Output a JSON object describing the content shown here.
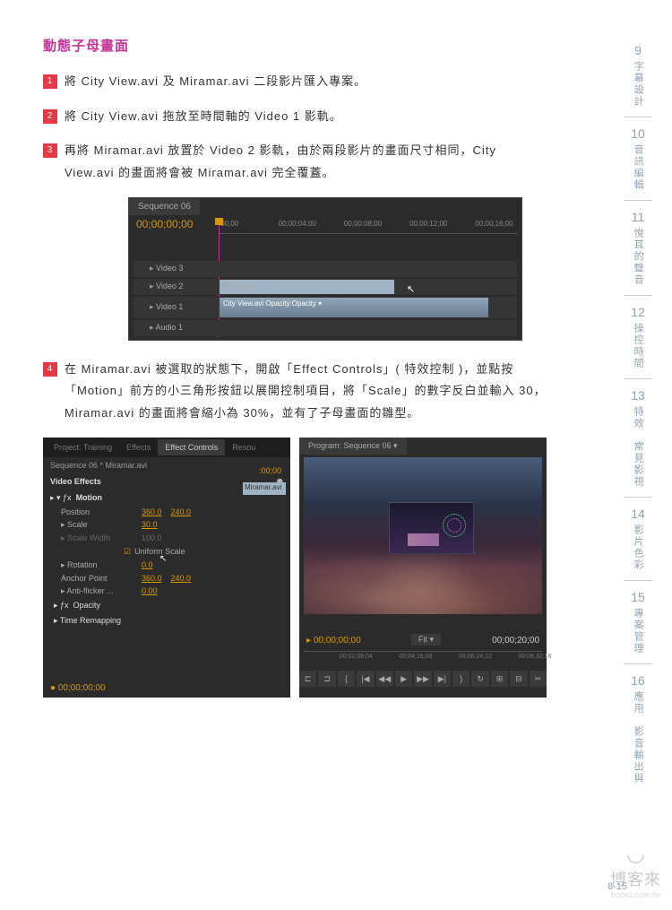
{
  "title": "動態子母畫面",
  "steps": [
    {
      "n": "1",
      "t": "將 City View.avi 及 Miramar.avi 二段影片匯入專案。"
    },
    {
      "n": "2",
      "t": "將 City View.avi 拖放至時間軸的 Video 1 影軌。"
    },
    {
      "n": "3",
      "t": "再將 Miramar.avi 放置於 Video 2 影軌，由於兩段影片的畫面尺寸相同，City View.avi 的畫面將會被 Miramar.avi 完全覆蓋。"
    },
    {
      "n": "4",
      "t": "在 Miramar.avi 被選取的狀態下，開啟「Effect Controls」( 特效控制 )，並點按「Motion」前方的小三角形按鈕以展開控制項目，將「Scale」的數字反白並輸入 30，Miramar.avi 的畫面將會縮小為 30%，並有了子母畫面的雛型。"
    }
  ],
  "timeline": {
    "tab": "Sequence 06",
    "time": "00;00;00;00",
    "ticks": [
      {
        "l": "0%",
        "t": ":00;00"
      },
      {
        "l": "20%",
        "t": "00;00;04;00"
      },
      {
        "l": "42%",
        "t": "00;00;08;00"
      },
      {
        "l": "64%",
        "t": "00;00;12;00"
      },
      {
        "l": "86%",
        "t": "00;00;16;00"
      }
    ],
    "tracks": {
      "v3": "Video 3",
      "v2": "Video 2",
      "v1": "Video 1",
      "a1": "Audio 1"
    },
    "clips": {
      "miramar": "Miramar.avi",
      "cityview": "City View.avi Opacity:Opacity ▾"
    }
  },
  "effects": {
    "tabs": {
      "project": "Project: Training",
      "eff": "Effects",
      "ec": "Effect Controls",
      "res": "Resou"
    },
    "sub": "Sequence 06 * Miramar.avi",
    "head": "Video Effects",
    "miniTime": ":00;00",
    "miniClip": "Miramar.avi",
    "motion": "Motion",
    "rows": {
      "position": {
        "l": "Position",
        "v1": "360.0",
        "v2": "240.0"
      },
      "scale": {
        "l": "Scale",
        "v": "30.0"
      },
      "scalew": {
        "l": "Scale Width",
        "v": "100.0"
      },
      "uniform": "Uniform Scale",
      "rotation": {
        "l": "Rotation",
        "v": "0.0"
      },
      "anchor": {
        "l": "Anchor Point",
        "v1": "360.0",
        "v2": "240.0"
      },
      "antiflicker": {
        "l": "Anti-flicker ...",
        "v": "0.00"
      }
    },
    "opacity": "Opacity",
    "timeremap": "Time Remapping",
    "bottomTime": "00;00;00;00"
  },
  "preview": {
    "tab": "Program: Sequence 06 ▾",
    "timeL": "00;00;00;00",
    "fit": "Fit ▾",
    "timeR": "00;00;20;00",
    "ticks": [
      {
        "l": "15%",
        "t": "00;02;08;04"
      },
      {
        "l": "40%",
        "t": "00;04;16;08"
      },
      {
        "l": "65%",
        "t": "00;06;24;12"
      },
      {
        "l": "90%",
        "t": "00;08;32;16"
      }
    ],
    "buttons": [
      "⊏",
      "⊐",
      "{",
      "|◀",
      "◀◀",
      "▶",
      "▶▶",
      "▶|",
      "}",
      "↻",
      "⊞",
      "⊟",
      "✂"
    ]
  },
  "sideNav": [
    {
      "n": "9",
      "t": "字幕設計"
    },
    {
      "n": "10",
      "t": "音訊編輯"
    },
    {
      "n": "11",
      "t": "悅耳的聲音"
    },
    {
      "n": "12",
      "t": "操控時間"
    },
    {
      "n": "13",
      "t": "特效　常見影視"
    },
    {
      "n": "14",
      "t": "影片色彩"
    },
    {
      "n": "15",
      "t": "專案管理"
    },
    {
      "n": "16",
      "t": "應用　影音輸出與"
    }
  ],
  "pageNum": "8-15",
  "watermark": {
    "logo": "◡",
    "text": "博客來",
    "url": "books.com.tw"
  }
}
